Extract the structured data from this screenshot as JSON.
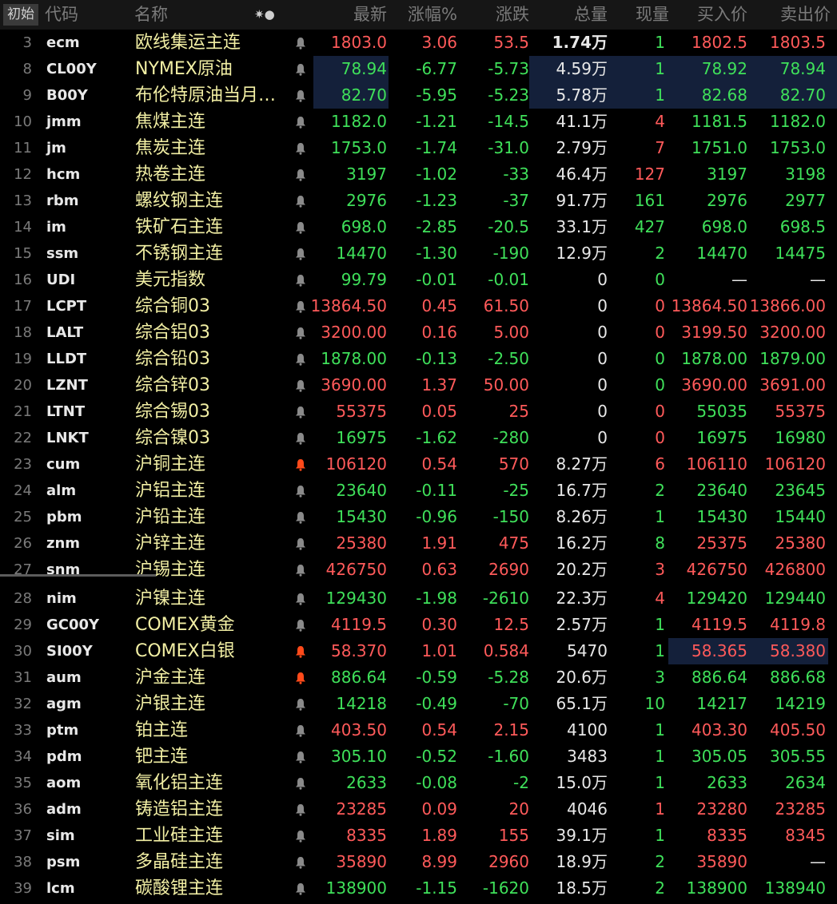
{
  "header": {
    "init_label": "初始",
    "cols": {
      "code": "代码",
      "name": "名称",
      "icons": "✷●",
      "last": "最新",
      "pct": "涨幅%",
      "chg": "涨跌",
      "vol": "总量",
      "cur": "现量",
      "bid": "买入价",
      "ask": "卖出价"
    }
  },
  "colors": {
    "up": "#ff5a5a",
    "down": "#3fe05a",
    "flat": "#e8e8e8",
    "name": "#f2efa4",
    "bell_active": "#ff4a1a",
    "bell_inactive": "#8a8a8a",
    "highlight": "#14203a"
  },
  "rows": [
    {
      "idx": "3",
      "code": "ecm",
      "name": "欧线集运主连",
      "bell": "inactive",
      "last": "1803.0",
      "pct": "3.06",
      "chg": "53.5",
      "vol": "1.74万",
      "cur": "1",
      "bid": "1802.5",
      "ask": "1803.5",
      "dir": "up",
      "cur_dir": "down",
      "bid_dir": "up",
      "ask_dir": "up",
      "vol_bold": true
    },
    {
      "idx": "8",
      "code": "CL00Y",
      "name": "NYMEX原油",
      "bell": "inactive",
      "last": "78.94",
      "pct": "-6.77",
      "chg": "-5.73",
      "vol": "4.59万",
      "cur": "1",
      "bid": "78.92",
      "ask": "78.94",
      "dir": "down",
      "cur_dir": "down",
      "bid_dir": "down",
      "ask_dir": "down",
      "vol_bold": false
    },
    {
      "idx": "9",
      "code": "B00Y",
      "name": "布伦特原油当月…",
      "bell": "inactive",
      "last": "82.70",
      "pct": "-5.95",
      "chg": "-5.23",
      "vol": "5.78万",
      "cur": "1",
      "bid": "82.68",
      "ask": "82.70",
      "dir": "down",
      "cur_dir": "down",
      "bid_dir": "down",
      "ask_dir": "down",
      "vol_bold": false
    },
    {
      "idx": "10",
      "code": "jmm",
      "name": "焦煤主连",
      "bell": "inactive",
      "last": "1182.0",
      "pct": "-1.21",
      "chg": "-14.5",
      "vol": "41.1万",
      "cur": "4",
      "bid": "1181.5",
      "ask": "1182.0",
      "dir": "down",
      "cur_dir": "up",
      "bid_dir": "down",
      "ask_dir": "down",
      "vol_bold": false
    },
    {
      "idx": "11",
      "code": "jm",
      "name": "焦炭主连",
      "bell": "inactive",
      "last": "1753.0",
      "pct": "-1.74",
      "chg": "-31.0",
      "vol": "2.79万",
      "cur": "7",
      "bid": "1751.0",
      "ask": "1753.0",
      "dir": "down",
      "cur_dir": "up",
      "bid_dir": "down",
      "ask_dir": "down",
      "vol_bold": false
    },
    {
      "idx": "12",
      "code": "hcm",
      "name": "热卷主连",
      "bell": "inactive",
      "last": "3197",
      "pct": "-1.02",
      "chg": "-33",
      "vol": "46.4万",
      "cur": "127",
      "bid": "3197",
      "ask": "3198",
      "dir": "down",
      "cur_dir": "up",
      "bid_dir": "down",
      "ask_dir": "down",
      "vol_bold": false
    },
    {
      "idx": "13",
      "code": "rbm",
      "name": "螺纹钢主连",
      "bell": "inactive",
      "last": "2976",
      "pct": "-1.23",
      "chg": "-37",
      "vol": "91.7万",
      "cur": "161",
      "bid": "2976",
      "ask": "2977",
      "dir": "down",
      "cur_dir": "down",
      "bid_dir": "down",
      "ask_dir": "down",
      "vol_bold": false
    },
    {
      "idx": "14",
      "code": "im",
      "name": "铁矿石主连",
      "bell": "inactive",
      "last": "698.0",
      "pct": "-2.85",
      "chg": "-20.5",
      "vol": "33.1万",
      "cur": "427",
      "bid": "698.0",
      "ask": "698.5",
      "dir": "down",
      "cur_dir": "down",
      "bid_dir": "down",
      "ask_dir": "down",
      "vol_bold": false
    },
    {
      "idx": "15",
      "code": "ssm",
      "name": "不锈钢主连",
      "bell": "inactive",
      "last": "14470",
      "pct": "-1.30",
      "chg": "-190",
      "vol": "12.9万",
      "cur": "2",
      "bid": "14470",
      "ask": "14475",
      "dir": "down",
      "cur_dir": "down",
      "bid_dir": "down",
      "ask_dir": "down",
      "vol_bold": false
    },
    {
      "idx": "16",
      "code": "UDI",
      "name": "美元指数",
      "bell": "inactive",
      "last": "99.79",
      "pct": "-0.01",
      "chg": "-0.01",
      "vol": "0",
      "cur": "0",
      "bid": "—",
      "ask": "—",
      "dir": "down",
      "cur_dir": "down",
      "bid_dir": "flat",
      "ask_dir": "flat",
      "vol_bold": false
    },
    {
      "idx": "17",
      "code": "LCPT",
      "name": "综合铜03",
      "bell": "inactive",
      "last": "13864.50",
      "pct": "0.45",
      "chg": "61.50",
      "vol": "0",
      "cur": "0",
      "bid": "13864.50",
      "ask": "13866.00",
      "dir": "up",
      "cur_dir": "up",
      "bid_dir": "up",
      "ask_dir": "up",
      "vol_bold": false
    },
    {
      "idx": "18",
      "code": "LALT",
      "name": "综合铝03",
      "bell": "inactive",
      "last": "3200.00",
      "pct": "0.16",
      "chg": "5.00",
      "vol": "0",
      "cur": "0",
      "bid": "3199.50",
      "ask": "3200.00",
      "dir": "up",
      "cur_dir": "up",
      "bid_dir": "up",
      "ask_dir": "up",
      "vol_bold": false
    },
    {
      "idx": "19",
      "code": "LLDT",
      "name": "综合铅03",
      "bell": "inactive",
      "last": "1878.00",
      "pct": "-0.13",
      "chg": "-2.50",
      "vol": "0",
      "cur": "0",
      "bid": "1878.00",
      "ask": "1879.00",
      "dir": "down",
      "cur_dir": "down",
      "bid_dir": "down",
      "ask_dir": "down",
      "vol_bold": false
    },
    {
      "idx": "20",
      "code": "LZNT",
      "name": "综合锌03",
      "bell": "inactive",
      "last": "3690.00",
      "pct": "1.37",
      "chg": "50.00",
      "vol": "0",
      "cur": "0",
      "bid": "3690.00",
      "ask": "3691.00",
      "dir": "up",
      "cur_dir": "down",
      "bid_dir": "up",
      "ask_dir": "up",
      "vol_bold": false
    },
    {
      "idx": "21",
      "code": "LTNT",
      "name": "综合锡03",
      "bell": "inactive",
      "last": "55375",
      "pct": "0.05",
      "chg": "25",
      "vol": "0",
      "cur": "0",
      "bid": "55035",
      "ask": "55375",
      "dir": "up",
      "cur_dir": "up",
      "bid_dir": "down",
      "ask_dir": "up",
      "vol_bold": false
    },
    {
      "idx": "22",
      "code": "LNKT",
      "name": "综合镍03",
      "bell": "inactive",
      "last": "16975",
      "pct": "-1.62",
      "chg": "-280",
      "vol": "0",
      "cur": "0",
      "bid": "16975",
      "ask": "16980",
      "dir": "down",
      "cur_dir": "up",
      "bid_dir": "down",
      "ask_dir": "down",
      "vol_bold": false
    },
    {
      "idx": "23",
      "code": "cum",
      "name": "沪铜主连",
      "bell": "active",
      "last": "106120",
      "pct": "0.54",
      "chg": "570",
      "vol": "8.27万",
      "cur": "6",
      "bid": "106110",
      "ask": "106120",
      "dir": "up",
      "cur_dir": "up",
      "bid_dir": "up",
      "ask_dir": "up",
      "vol_bold": false
    },
    {
      "idx": "24",
      "code": "alm",
      "name": "沪铝主连",
      "bell": "inactive",
      "last": "23640",
      "pct": "-0.11",
      "chg": "-25",
      "vol": "16.7万",
      "cur": "2",
      "bid": "23640",
      "ask": "23645",
      "dir": "down",
      "cur_dir": "down",
      "bid_dir": "down",
      "ask_dir": "down",
      "vol_bold": false
    },
    {
      "idx": "25",
      "code": "pbm",
      "name": "沪铅主连",
      "bell": "inactive",
      "last": "15430",
      "pct": "-0.96",
      "chg": "-150",
      "vol": "8.26万",
      "cur": "1",
      "bid": "15430",
      "ask": "15440",
      "dir": "down",
      "cur_dir": "down",
      "bid_dir": "down",
      "ask_dir": "down",
      "vol_bold": false
    },
    {
      "idx": "26",
      "code": "znm",
      "name": "沪锌主连",
      "bell": "inactive",
      "last": "25380",
      "pct": "1.91",
      "chg": "475",
      "vol": "16.2万",
      "cur": "8",
      "bid": "25375",
      "ask": "25380",
      "dir": "up",
      "cur_dir": "down",
      "bid_dir": "up",
      "ask_dir": "up",
      "vol_bold": false
    },
    {
      "idx": "27",
      "code": "snm",
      "name": "沪锡主连",
      "bell": "inactive",
      "last": "426750",
      "pct": "0.63",
      "chg": "2690",
      "vol": "20.2万",
      "cur": "3",
      "bid": "426750",
      "ask": "426800",
      "dir": "up",
      "cur_dir": "up",
      "bid_dir": "up",
      "ask_dir": "up",
      "vol_bold": false
    },
    {
      "idx": "28",
      "code": "nim",
      "name": "沪镍主连",
      "bell": "inactive",
      "last": "129430",
      "pct": "-1.98",
      "chg": "-2610",
      "vol": "22.3万",
      "cur": "4",
      "bid": "129420",
      "ask": "129440",
      "dir": "down",
      "cur_dir": "up",
      "bid_dir": "down",
      "ask_dir": "down",
      "vol_bold": false
    },
    {
      "idx": "29",
      "code": "GC00Y",
      "name": "COMEX黄金",
      "bell": "inactive",
      "last": "4119.5",
      "pct": "0.30",
      "chg": "12.5",
      "vol": "2.57万",
      "cur": "1",
      "bid": "4119.5",
      "ask": "4119.8",
      "dir": "up",
      "cur_dir": "down",
      "bid_dir": "up",
      "ask_dir": "up",
      "vol_bold": false
    },
    {
      "idx": "30",
      "code": "SI00Y",
      "name": "COMEX白银",
      "bell": "active",
      "last": "58.370",
      "pct": "1.01",
      "chg": "0.584",
      "vol": "5470",
      "cur": "1",
      "bid": "58.365",
      "ask": "58.380",
      "dir": "up",
      "cur_dir": "down",
      "bid_dir": "up",
      "ask_dir": "up",
      "vol_bold": false
    },
    {
      "idx": "31",
      "code": "aum",
      "name": "沪金主连",
      "bell": "active",
      "last": "886.64",
      "pct": "-0.59",
      "chg": "-5.28",
      "vol": "20.6万",
      "cur": "3",
      "bid": "886.64",
      "ask": "886.68",
      "dir": "down",
      "cur_dir": "down",
      "bid_dir": "down",
      "ask_dir": "down",
      "vol_bold": false
    },
    {
      "idx": "32",
      "code": "agm",
      "name": "沪银主连",
      "bell": "inactive",
      "last": "14218",
      "pct": "-0.49",
      "chg": "-70",
      "vol": "65.1万",
      "cur": "10",
      "bid": "14217",
      "ask": "14219",
      "dir": "down",
      "cur_dir": "down",
      "bid_dir": "down",
      "ask_dir": "down",
      "vol_bold": false
    },
    {
      "idx": "33",
      "code": "ptm",
      "name": "铂主连",
      "bell": "inactive",
      "last": "403.50",
      "pct": "0.54",
      "chg": "2.15",
      "vol": "4100",
      "cur": "1",
      "bid": "403.30",
      "ask": "405.50",
      "dir": "up",
      "cur_dir": "down",
      "bid_dir": "up",
      "ask_dir": "up",
      "vol_bold": false
    },
    {
      "idx": "34",
      "code": "pdm",
      "name": "钯主连",
      "bell": "inactive",
      "last": "305.10",
      "pct": "-0.52",
      "chg": "-1.60",
      "vol": "3483",
      "cur": "1",
      "bid": "305.05",
      "ask": "305.55",
      "dir": "down",
      "cur_dir": "down",
      "bid_dir": "down",
      "ask_dir": "down",
      "vol_bold": false
    },
    {
      "idx": "35",
      "code": "aom",
      "name": "氧化铝主连",
      "bell": "inactive",
      "last": "2633",
      "pct": "-0.08",
      "chg": "-2",
      "vol": "15.0万",
      "cur": "1",
      "bid": "2633",
      "ask": "2634",
      "dir": "down",
      "cur_dir": "down",
      "bid_dir": "down",
      "ask_dir": "down",
      "vol_bold": false
    },
    {
      "idx": "36",
      "code": "adm",
      "name": "铸造铝主连",
      "bell": "inactive",
      "last": "23285",
      "pct": "0.09",
      "chg": "20",
      "vol": "4046",
      "cur": "1",
      "bid": "23280",
      "ask": "23285",
      "dir": "up",
      "cur_dir": "up",
      "bid_dir": "up",
      "ask_dir": "up",
      "vol_bold": false
    },
    {
      "idx": "37",
      "code": "sim",
      "name": "工业硅主连",
      "bell": "inactive",
      "last": "8335",
      "pct": "1.89",
      "chg": "155",
      "vol": "39.1万",
      "cur": "1",
      "bid": "8335",
      "ask": "8345",
      "dir": "up",
      "cur_dir": "down",
      "bid_dir": "up",
      "ask_dir": "up",
      "vol_bold": false
    },
    {
      "idx": "38",
      "code": "psm",
      "name": "多晶硅主连",
      "bell": "inactive",
      "last": "35890",
      "pct": "8.99",
      "chg": "2960",
      "vol": "18.9万",
      "cur": "2",
      "bid": "35890",
      "ask": "—",
      "dir": "up",
      "cur_dir": "down",
      "bid_dir": "up",
      "ask_dir": "flat",
      "vol_bold": false
    },
    {
      "idx": "39",
      "code": "lcm",
      "name": "碳酸锂主连",
      "bell": "inactive",
      "last": "138900",
      "pct": "-1.15",
      "chg": "-1620",
      "vol": "18.5万",
      "cur": "2",
      "bid": "138900",
      "ask": "138940",
      "dir": "down",
      "cur_dir": "down",
      "bid_dir": "down",
      "ask_dir": "down",
      "vol_bold": false
    }
  ]
}
